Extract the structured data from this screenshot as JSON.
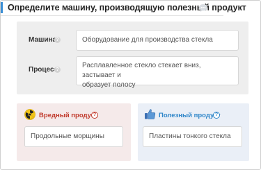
{
  "header": {
    "title": "Определите машину, производящую полезный продукт",
    "chat_icon": "chat-bubble-icon"
  },
  "machine": {
    "label": "Машина",
    "help": "?",
    "value": "",
    "placeholder": "Оборудование для производства стекла"
  },
  "process": {
    "label": "Процесс",
    "help": "?",
    "value": "",
    "placeholder_line1": "Расплавленное стекло стекает вниз, застывает и",
    "placeholder_line2": "образует полосу"
  },
  "harmful": {
    "title": "Вредный продукт",
    "help": "?",
    "icon": "radiation-hazard-icon",
    "placeholder": "Продольные морщины",
    "accent_color": "#c0392b"
  },
  "useful": {
    "title": "Полезный продукт",
    "help": "?",
    "icon": "thumbs-up-icon",
    "placeholder": "Пластины тонкого стекла",
    "accent_color": "#2f86c9"
  }
}
